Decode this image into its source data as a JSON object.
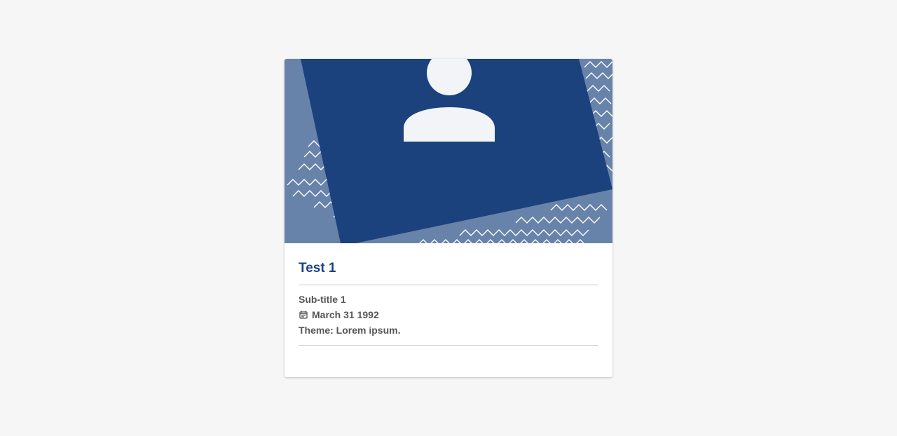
{
  "card": {
    "title": "Test 1",
    "subtitle": "Sub-title 1",
    "date": "March 31 1992",
    "theme": "Theme: Lorem ipsum.",
    "icons": {
      "avatar": "person-placeholder-icon",
      "date": "calendar-icon"
    }
  },
  "colors": {
    "background": "#f6f6f6",
    "card": "#ffffff",
    "accent": "#1b427d",
    "image_light": "#6883aa",
    "image_dark": "#1b427d",
    "avatar": "#f2f4f8",
    "text_muted": "#555555"
  }
}
